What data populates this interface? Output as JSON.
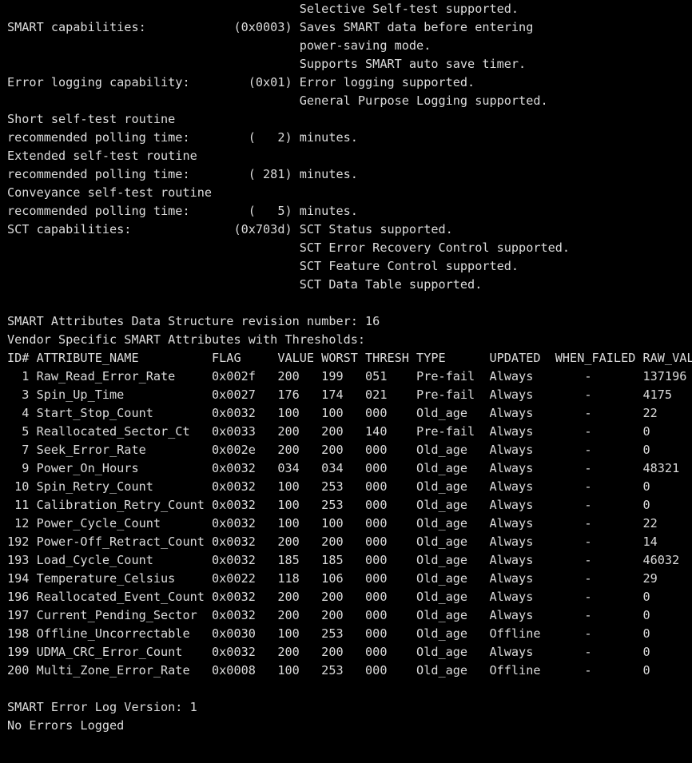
{
  "terminal": {
    "background": "#000000",
    "foreground": "#dcdcdc",
    "lines": [
      "                                        Selective Self-test supported.",
      "SMART capabilities:            (0x0003) Saves SMART data before entering",
      "                                        power-saving mode.",
      "                                        Supports SMART auto save timer.",
      "Error logging capability:        (0x01) Error logging supported.",
      "                                        General Purpose Logging supported.",
      "Short self-test routine",
      "recommended polling time:        (   2) minutes.",
      "Extended self-test routine",
      "recommended polling time:        ( 281) minutes.",
      "Conveyance self-test routine",
      "recommended polling time:        (   5) minutes.",
      "SCT capabilities:              (0x703d) SCT Status supported.",
      "                                        SCT Error Recovery Control supported.",
      "                                        SCT Feature Control supported.",
      "                                        SCT Data Table supported.",
      "",
      "SMART Attributes Data Structure revision number: 16",
      "Vendor Specific SMART Attributes with Thresholds:",
      "ID# ATTRIBUTE_NAME          FLAG     VALUE WORST THRESH TYPE      UPDATED  WHEN_FAILED RAW_VALUE",
      "  1 Raw_Read_Error_Rate     0x002f   200   199   051    Pre-fail  Always       -       137196",
      "  3 Spin_Up_Time            0x0027   176   174   021    Pre-fail  Always       -       4175",
      "  4 Start_Stop_Count        0x0032   100   100   000    Old_age   Always       -       22",
      "  5 Reallocated_Sector_Ct   0x0033   200   200   140    Pre-fail  Always       -       0",
      "  7 Seek_Error_Rate         0x002e   200   200   000    Old_age   Always       -       0",
      "  9 Power_On_Hours          0x0032   034   034   000    Old_age   Always       -       48321",
      " 10 Spin_Retry_Count        0x0032   100   253   000    Old_age   Always       -       0",
      " 11 Calibration_Retry_Count 0x0032   100   253   000    Old_age   Always       -       0",
      " 12 Power_Cycle_Count       0x0032   100   100   000    Old_age   Always       -       22",
      "192 Power-Off_Retract_Count 0x0032   200   200   000    Old_age   Always       -       14",
      "193 Load_Cycle_Count        0x0032   185   185   000    Old_age   Always       -       46032",
      "194 Temperature_Celsius     0x0022   118   106   000    Old_age   Always       -       29",
      "196 Reallocated_Event_Count 0x0032   200   200   000    Old_age   Always       -       0",
      "197 Current_Pending_Sector  0x0032   200   200   000    Old_age   Always       -       0",
      "198 Offline_Uncorrectable   0x0030   100   253   000    Old_age   Offline      -       0",
      "199 UDMA_CRC_Error_Count    0x0032   200   200   000    Old_age   Always       -       0",
      "200 Multi_Zone_Error_Rate   0x0008   100   253   000    Old_age   Offline      -       0",
      "",
      "SMART Error Log Version: 1",
      "No Errors Logged"
    ]
  }
}
